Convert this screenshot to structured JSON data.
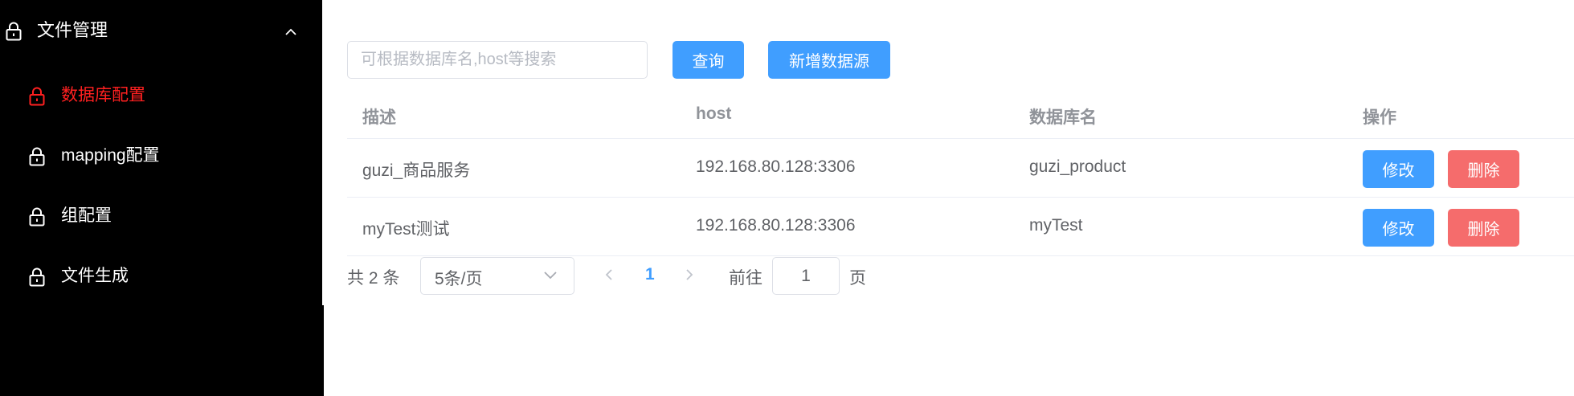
{
  "sidebar": {
    "group_label": "文件管理",
    "items": [
      {
        "label": "数据库配置",
        "active": true
      },
      {
        "label": "mapping配置",
        "active": false
      },
      {
        "label": "组配置",
        "active": false
      },
      {
        "label": "文件生成",
        "active": false
      }
    ]
  },
  "toolbar": {
    "search_placeholder": "可根据数据库名,host等搜索",
    "search_value": "",
    "query_label": "查询",
    "add_label": "新增数据源"
  },
  "table": {
    "headers": [
      "描述",
      "host",
      "数据库名",
      "操作"
    ],
    "rows": [
      {
        "desc": "guzi_商品服务",
        "host": "192.168.80.128:3306",
        "db": "guzi_product",
        "edit_label": "修改",
        "delete_label": "删除"
      },
      {
        "desc": "myTest测试",
        "host": "192.168.80.128:3306",
        "db": "myTest",
        "edit_label": "修改",
        "delete_label": "删除"
      }
    ]
  },
  "pagination": {
    "total_text": "共 2 条",
    "page_size": "5条/页",
    "current_page": "1",
    "goto_label": "前往",
    "goto_value": "1",
    "page_unit": "页"
  },
  "colors": {
    "primary": "#409eff",
    "danger": "#f56c6c",
    "active_menu": "#ff2020",
    "sidebar_bg": "#000000"
  }
}
